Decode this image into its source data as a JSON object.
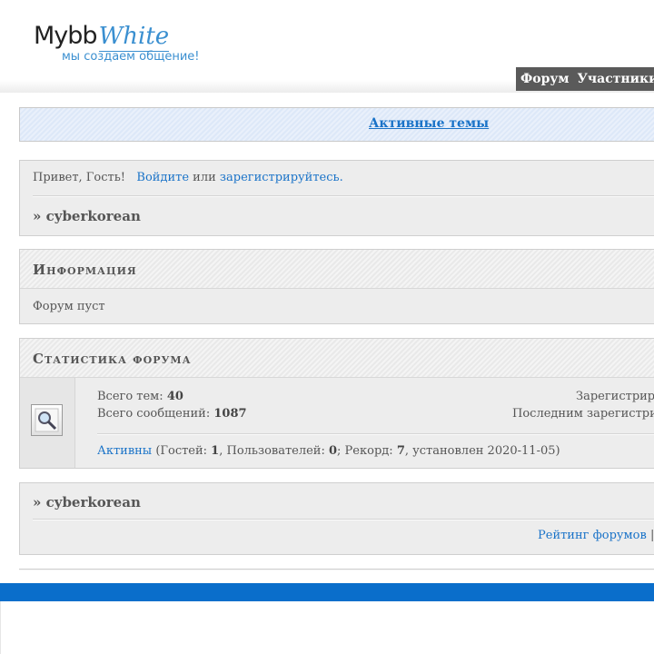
{
  "header": {
    "logo_main": "Mybb",
    "logo_accent": "White",
    "slogan": "мы создаем общение!",
    "nav": [
      "Форум",
      "Участники"
    ]
  },
  "active_topics": "Активные темы",
  "welcome": {
    "greeting": "Привет, Гость!",
    "login": "Войдите",
    "or": "или",
    "register": "зарегистрируйтесь.",
    "breadcrumb": "» cyberkorean"
  },
  "info": {
    "title": "Информация",
    "message": "Форум пуст"
  },
  "stats": {
    "title": "Статистика форума",
    "topics_label": "Всего тем:",
    "topics_value": "40",
    "posts_label": "Всего сообщений:",
    "posts_value": "1087",
    "registered_label": "Зарегистрир",
    "last_registered_label": "Последним зарегистри",
    "active_link": "Активны",
    "guests_label": "(Гостей:",
    "guests_value": "1",
    "users_label": ", Пользователей:",
    "users_value": "0",
    "record_label": "; Рекорд:",
    "record_value": "7",
    "record_date": ", установлен 2020-11-05)"
  },
  "bottom": {
    "breadcrumb": "» cyberkorean",
    "rating_link": "Рейтинг форумов",
    "rating_sep": "|"
  },
  "colors": {
    "link": "#1a73c8",
    "footer_bar": "#0a6ecb",
    "nav_bg": "#5a5a5a"
  }
}
